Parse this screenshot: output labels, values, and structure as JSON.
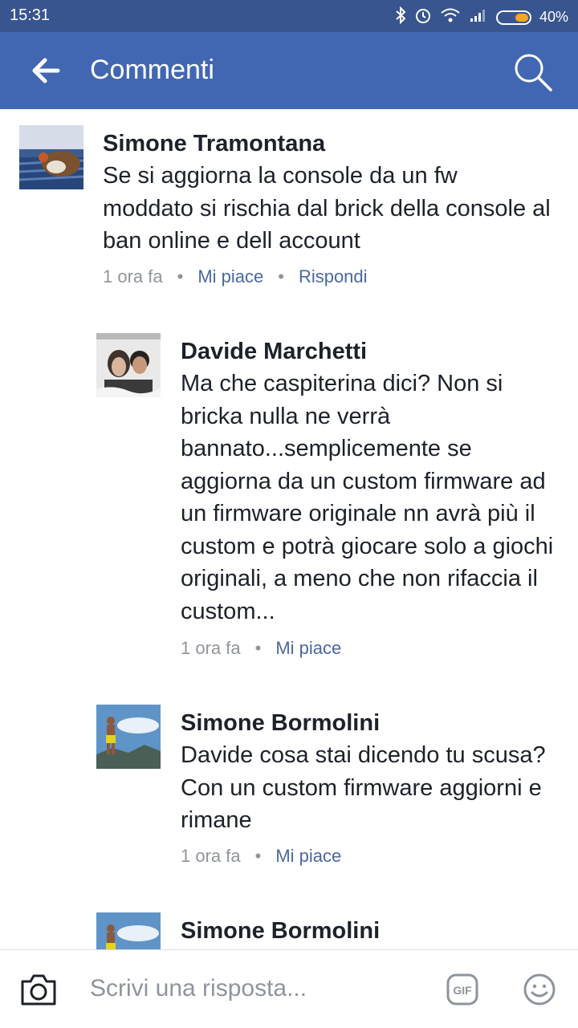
{
  "status": {
    "time": "15:31",
    "battery": "40%"
  },
  "appbar": {
    "title": "Commenti"
  },
  "comments": [
    {
      "author": "Simone Tramontana",
      "text": "Se si aggiorna la console da un fw moddato si rischia dal brick della console al ban online e dell account",
      "time": "1 ora fa",
      "like": "Mi piace",
      "reply": "Rispondi"
    },
    {
      "author": "Davide Marchetti",
      "text": "Ma che caspiterina dici? Non si bricka nulla ne verrà bannato...semplicemente se aggiorna da un custom firmware ad un firmware originale nn avrà più il custom e potrà giocare solo a giochi originali, a meno che non rifaccia il custom...",
      "time": "1 ora fa",
      "like": "Mi piace"
    },
    {
      "author": "Simone Bormolini",
      "text": "Davide cosa stai dicendo tu scusa? Con un custom firmware aggiorni e rimane",
      "time": "1 ora fa",
      "like": "Mi piace"
    },
    {
      "author": "Simone Bormolini"
    }
  ],
  "composer": {
    "placeholder": "Scrivi una risposta...",
    "gif": "GIF"
  },
  "icons": {
    "back": "arrow-left-icon",
    "search": "search-icon",
    "camera": "camera-icon",
    "gif": "gif-icon",
    "emoji": "smiley-icon"
  },
  "colors": {
    "appbar": "#4267b2",
    "statusbar": "#39558f",
    "link": "#4b67a1",
    "meta": "#90949c"
  }
}
